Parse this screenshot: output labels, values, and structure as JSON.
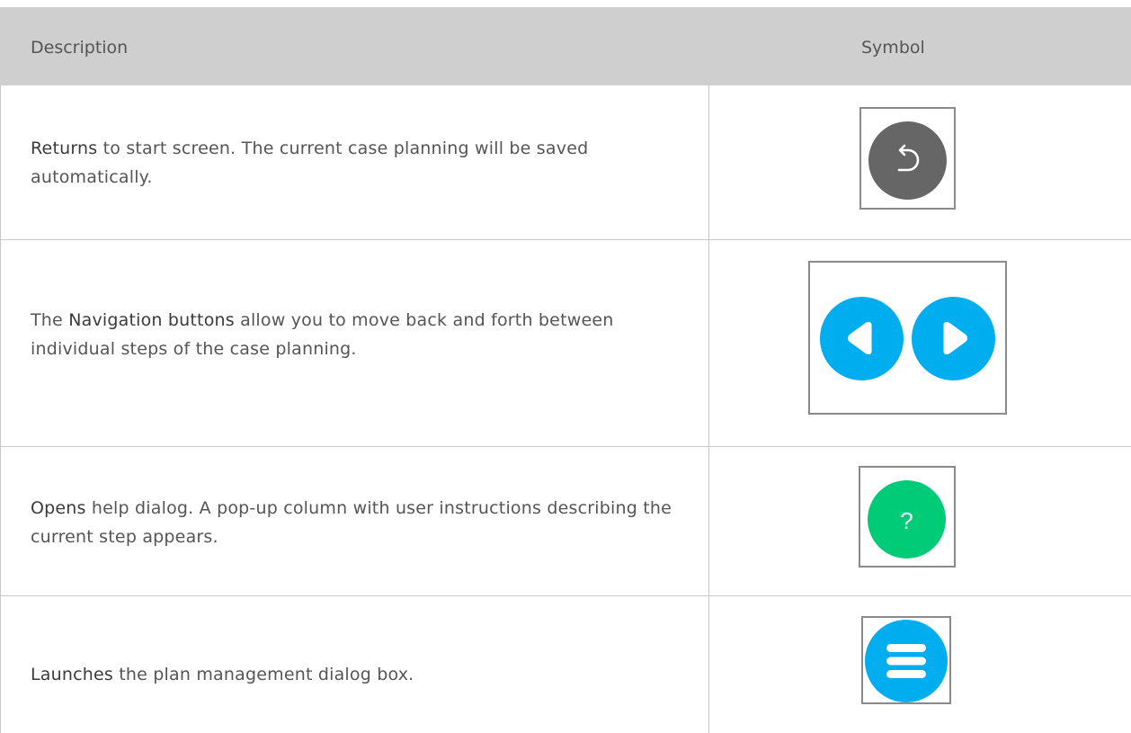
{
  "header": {
    "description_label": "Description",
    "symbol_label": "Symbol"
  },
  "rows": [
    {
      "keyword": "Returns",
      "text": " to start screen. The current case planning will be saved automatically.",
      "icon": "return-icon",
      "icon_color": "#666666"
    },
    {
      "prefix": "The ",
      "keyword": "Navigation buttons",
      "text": " allow you to move back and forth between individual steps of the case planning.",
      "icons": [
        "back-arrow-icon",
        "forward-arrow-icon"
      ],
      "icon_color": "#00aeef"
    },
    {
      "keyword": "Opens",
      "text": " help dialog. A pop-up column with user instructions describing the current step appears.",
      "icon": "help-icon",
      "icon_glyph": "?",
      "icon_color": "#00cc77"
    },
    {
      "keyword": "Launches",
      "text": " the plan management dialog box.",
      "icon": "menu-icon",
      "icon_color": "#00aeef"
    }
  ]
}
